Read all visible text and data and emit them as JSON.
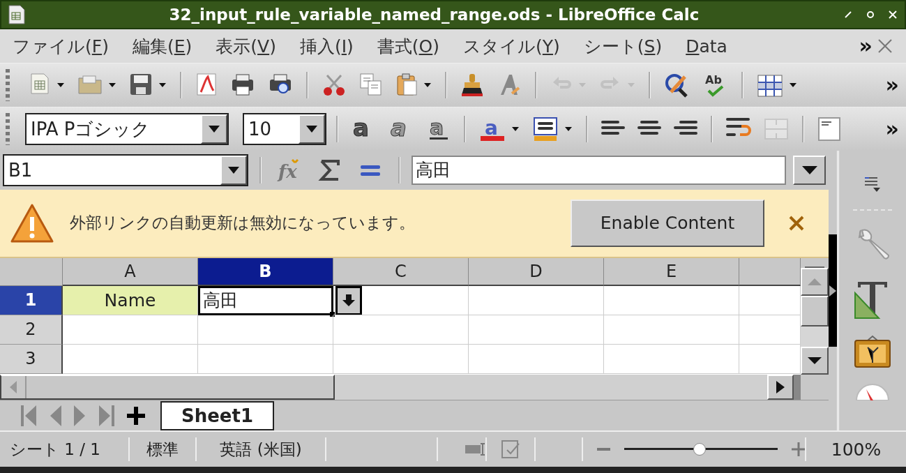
{
  "window": {
    "title": "32_input_rule_variable_named_range.ods - LibreOffice Calc"
  },
  "menu": [
    {
      "before": "ファイル(",
      "key": "F",
      "after": ")"
    },
    {
      "before": "編集(",
      "key": "E",
      "after": ")"
    },
    {
      "before": "表示(",
      "key": "V",
      "after": ")"
    },
    {
      "before": "挿入(",
      "key": "I",
      "after": ")"
    },
    {
      "before": "書式(",
      "key": "O",
      "after": ")"
    },
    {
      "before": "スタイル(",
      "key": "Y",
      "after": ")"
    },
    {
      "before": "シート(",
      "key": "S",
      "after": ")"
    },
    {
      "key": "D",
      "after": "ata"
    }
  ],
  "icon_letters": {
    "spellcheck": "Ab",
    "bold": "a",
    "italic": "a",
    "underline": "a",
    "font_color": "a",
    "function_wizard": "fx"
  },
  "menu_overflow": "»",
  "toolbar_overflow": "»",
  "formatting": {
    "font_name": "IPA Pゴシック",
    "font_size": "10",
    "overflow": "»"
  },
  "formula_bar": {
    "cell_reference": "B1",
    "content": "高田"
  },
  "infobar": {
    "message": "外部リンクの自動更新は無効になっています。",
    "button": "Enable Content"
  },
  "sheet": {
    "columns": [
      {
        "label": "A",
        "selected": false
      },
      {
        "label": "B",
        "selected": true
      },
      {
        "label": "C",
        "selected": false
      },
      {
        "label": "D",
        "selected": false
      },
      {
        "label": "E",
        "selected": false
      }
    ],
    "rows": [
      {
        "label": "1",
        "selected": true,
        "cells": [
          {
            "text": "Name",
            "highlighted": true,
            "active": false
          },
          {
            "text": "高田",
            "highlighted": false,
            "active": true
          }
        ]
      },
      {
        "label": "2",
        "selected": false,
        "cells": []
      },
      {
        "label": "3",
        "selected": false,
        "cells": []
      }
    ]
  },
  "sheet_tabs": [
    {
      "label": "Sheet1",
      "selected": true
    }
  ],
  "status_bar": {
    "sheet": "シート 1 / 1",
    "page_style": "標準",
    "language": "英語 (米国)",
    "zoom_slider": {
      "level": 0.49
    },
    "zoom": "100%"
  }
}
